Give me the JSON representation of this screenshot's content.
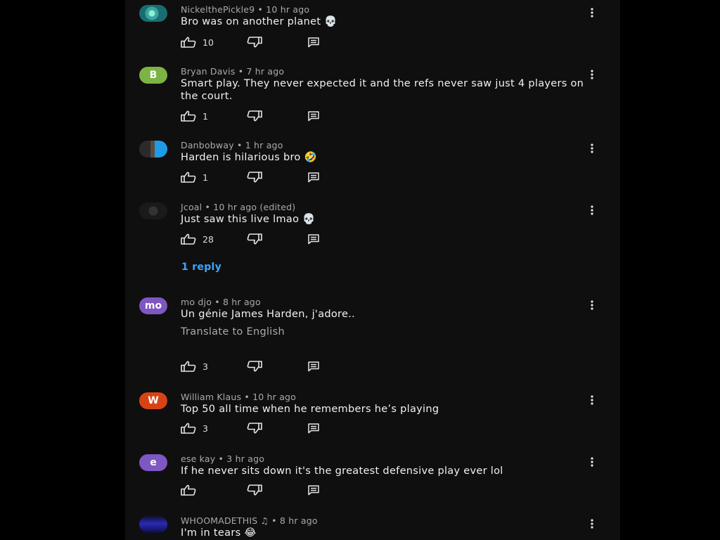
{
  "colors": {
    "background": "#0f0f0f",
    "text": "#f1f1f1",
    "meta": "#aaaaaa",
    "link": "#3ea6ff"
  },
  "comments": [
    {
      "author": "NickelthePickle9",
      "time": "10 hr ago",
      "text": "Bro was on another planet 💀",
      "likes": "10",
      "avatar": {
        "type": "image",
        "icon": "gem-avatar"
      }
    },
    {
      "author": "Bryan Davis",
      "time": "7 hr ago",
      "text": "Smart play. They never expected it and the refs never saw just 4 players on the court.",
      "likes": "1",
      "avatar": {
        "type": "letter",
        "letter": "B",
        "color": "#7cb342"
      }
    },
    {
      "author": "Danbobway",
      "time": "1 hr ago",
      "text": "Harden is hilarious bro 🤣",
      "likes": "1",
      "avatar": {
        "type": "image",
        "icon": "photo-avatar"
      }
    },
    {
      "author": "Jcoal",
      "time": "10 hr ago (edited)",
      "text": "Just saw this live lmao 💀",
      "likes": "28",
      "avatar": {
        "type": "image",
        "icon": "dark-avatar"
      },
      "replies_label": "1 reply"
    },
    {
      "author": "mo djo",
      "time": "8 hr ago",
      "text": "Un génie James Harden, j'adore..",
      "likes": "3",
      "avatar": {
        "type": "letter",
        "letter": "mo",
        "color": "#7e57c2"
      },
      "translate_label": "Translate to English"
    },
    {
      "author": "William Klaus",
      "time": "10 hr ago",
      "text": "Top 50 all time when he remembers he’s playing",
      "likes": "3",
      "avatar": {
        "type": "letter",
        "letter": "W",
        "color": "#d84315"
      }
    },
    {
      "author": "ese kay",
      "time": "3 hr ago",
      "text": "If he never sits down it's the greatest defensive play ever lol",
      "likes": "",
      "avatar": {
        "type": "letter",
        "letter": "e",
        "color": "#7e57c2"
      }
    },
    {
      "author": "WHOOMADETHIS",
      "author_badge": "♫",
      "time": "8 hr ago",
      "text": "I'm in tears 😂",
      "likes": "",
      "avatar": {
        "type": "image",
        "icon": "blue-art-avatar"
      }
    }
  ]
}
